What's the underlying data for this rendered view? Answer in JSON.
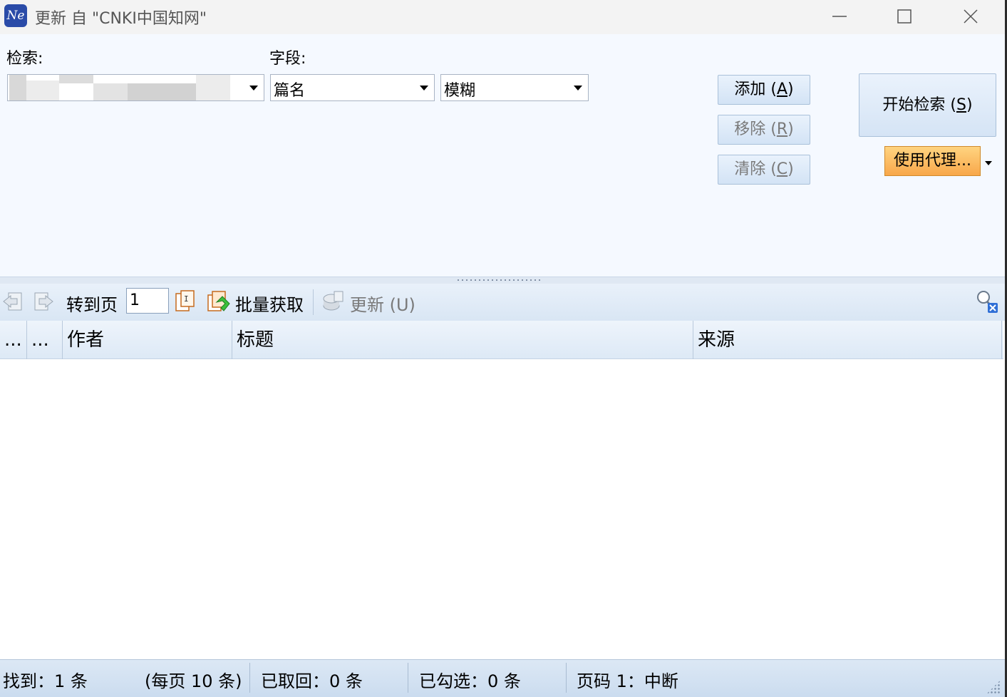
{
  "window": {
    "title": "更新 自 \"CNKI中国知网\"",
    "app_icon_text": "Ne",
    "controls": [
      "minimize",
      "maximize",
      "close"
    ]
  },
  "search": {
    "query_label": "检索:",
    "query_value": "",
    "field_label": "字段:",
    "field_value": "篇名",
    "match_value": "模糊",
    "buttons": {
      "add": "添加 (",
      "add_key": "A",
      "remove": "移除 (",
      "remove_key": "R",
      "clear": "清除 (",
      "clear_key": "C",
      "start": "开始检索 (",
      "start_key": "S",
      "proxy": "使用代理..."
    }
  },
  "toolbar": {
    "goto_page_label": "转到页",
    "page_value": "1",
    "batch_fetch_label": "批量获取",
    "update_label": "更新 (U)"
  },
  "grid": {
    "columns": [
      "...",
      "...",
      "作者",
      "标题",
      "来源"
    ],
    "rows": []
  },
  "status": {
    "found": "找到：1 条",
    "per_page": "(每页 10 条)",
    "retrieved": "已取回：0 条",
    "checked": "已勾选：0 条",
    "page": "页码 1：中断"
  },
  "colors": {
    "accent_button": "#f8a74a",
    "panel_bg": "#f5f9ff",
    "toolbar_bg": "#d9e6f4"
  }
}
